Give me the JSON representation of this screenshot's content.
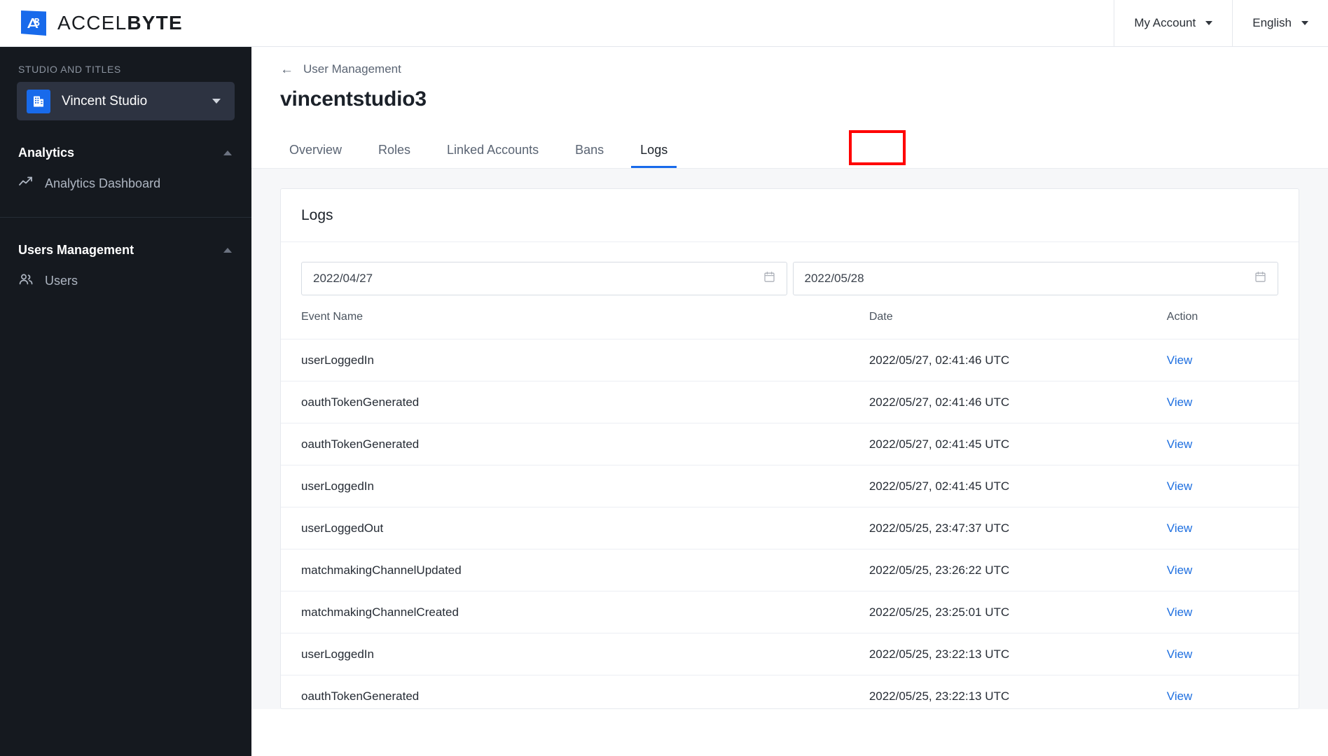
{
  "topbar": {
    "brand_prefix": "ACCEL",
    "brand_suffix": "BYTE",
    "brand_icon": "accelbyte-logo-icon",
    "account_label": "My Account",
    "language_label": "English"
  },
  "sidebar": {
    "section_label": "STUDIO AND TITLES",
    "studio": {
      "name": "Vincent Studio",
      "icon": "building-icon"
    },
    "groups": [
      {
        "title": "Analytics",
        "items": [
          {
            "label": "Analytics Dashboard",
            "icon": "trending-up-icon"
          }
        ]
      },
      {
        "title": "Users Management",
        "items": [
          {
            "label": "Users",
            "icon": "users-icon"
          }
        ]
      }
    ]
  },
  "main": {
    "breadcrumb": "User Management",
    "back_icon": "arrow-left-icon",
    "page_title": "vincentstudio3",
    "tabs": [
      {
        "label": "Overview",
        "active": false
      },
      {
        "label": "Roles",
        "active": false
      },
      {
        "label": "Linked Accounts",
        "active": false
      },
      {
        "label": "Bans",
        "active": false
      },
      {
        "label": "Logs",
        "active": true
      }
    ],
    "highlight_color": "#ff0000",
    "accent_color": "#186aeb"
  },
  "card": {
    "title": "Logs",
    "date_from": "2022/04/27",
    "date_to": "2022/05/28",
    "calendar_icon": "calendar-icon",
    "columns": [
      "Event Name",
      "Date",
      "Action"
    ],
    "action_label": "View",
    "rows": [
      {
        "event": "userLoggedIn",
        "date": "2022/05/27, 02:41:46 UTC",
        "action": "View"
      },
      {
        "event": "oauthTokenGenerated",
        "date": "2022/05/27, 02:41:46 UTC",
        "action": "View"
      },
      {
        "event": "oauthTokenGenerated",
        "date": "2022/05/27, 02:41:45 UTC",
        "action": "View"
      },
      {
        "event": "userLoggedIn",
        "date": "2022/05/27, 02:41:45 UTC",
        "action": "View"
      },
      {
        "event": "userLoggedOut",
        "date": "2022/05/25, 23:47:37 UTC",
        "action": "View"
      },
      {
        "event": "matchmakingChannelUpdated",
        "date": "2022/05/25, 23:26:22 UTC",
        "action": "View"
      },
      {
        "event": "matchmakingChannelCreated",
        "date": "2022/05/25, 23:25:01 UTC",
        "action": "View"
      },
      {
        "event": "userLoggedIn",
        "date": "2022/05/25, 23:22:13 UTC",
        "action": "View"
      },
      {
        "event": "oauthTokenGenerated",
        "date": "2022/05/25, 23:22:13 UTC",
        "action": "View"
      }
    ]
  }
}
